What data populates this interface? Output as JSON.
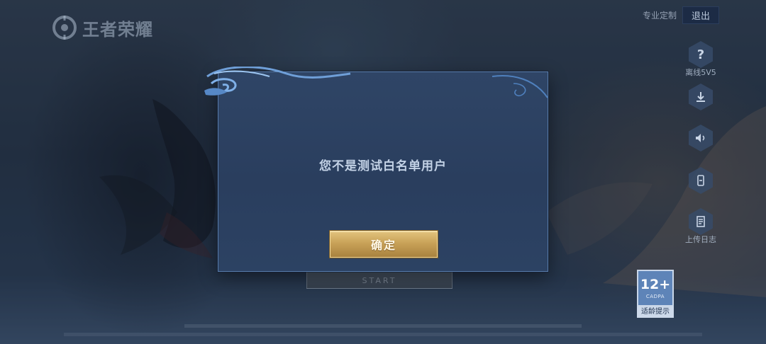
{
  "app": {
    "logo_text": "王者荣耀"
  },
  "top_bar": {
    "custom_label": "专业定制",
    "exit_label": "退出"
  },
  "side_buttons": [
    {
      "icon": "help-icon",
      "glyph": "?",
      "label": "离线5V5"
    },
    {
      "icon": "download-icon",
      "label": ""
    },
    {
      "icon": "sound-icon",
      "label": ""
    },
    {
      "icon": "phone-icon",
      "label": ""
    },
    {
      "icon": "log-upload-icon",
      "label": "上传日志"
    }
  ],
  "start_button": {
    "label": "START"
  },
  "age_badge": {
    "rating": "12+",
    "org": "CADPA",
    "tip": "适龄提示"
  },
  "dialog": {
    "message": "您不是测试白名单用户",
    "confirm_label": "确定"
  },
  "colors": {
    "dialog_bg": "#2f4566",
    "dialog_border": "#587cab",
    "confirm_gold": "#c9a258",
    "age_badge_blue": "#5e84b8"
  }
}
